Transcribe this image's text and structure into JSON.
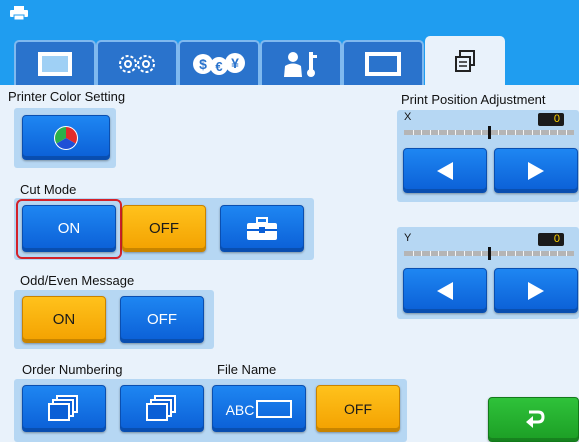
{
  "titlebar": {
    "icon": "printer-icon"
  },
  "tabs": [
    {
      "icon": "screen-icon",
      "active": false
    },
    {
      "icon": "gears-icon",
      "active": false
    },
    {
      "icon": "currency-icon",
      "active": false
    },
    {
      "icon": "user-key-icon",
      "active": false
    },
    {
      "icon": "frame-icon",
      "active": false
    },
    {
      "icon": "printer-stack-icon",
      "active": true
    }
  ],
  "sections": {
    "printer_color": {
      "label": "Printer Color Setting",
      "button_icon": "color-wheel-icon"
    },
    "cut_mode": {
      "label": "Cut Mode",
      "on": "ON",
      "off": "OFF",
      "selected": "ON",
      "tool_icon": "toolbox-icon"
    },
    "odd_even": {
      "label": "Odd/Even Message",
      "on": "ON",
      "off": "OFF",
      "selected": "ON"
    },
    "order_numbering": {
      "label": "Order Numbering"
    },
    "file_name": {
      "label": "File Name",
      "abc": "ABC",
      "off": "OFF"
    }
  },
  "print_position": {
    "label": "Print Position Adjustment",
    "x": {
      "axis": "X",
      "value": "0"
    },
    "y": {
      "axis": "Y",
      "value": "0"
    }
  },
  "return_button": {
    "icon": "return-arrow-icon"
  },
  "colors": {
    "blue": "#1e86f2",
    "orange": "#f3a100",
    "green": "#1c9e25",
    "highlight": "#d3222a"
  }
}
